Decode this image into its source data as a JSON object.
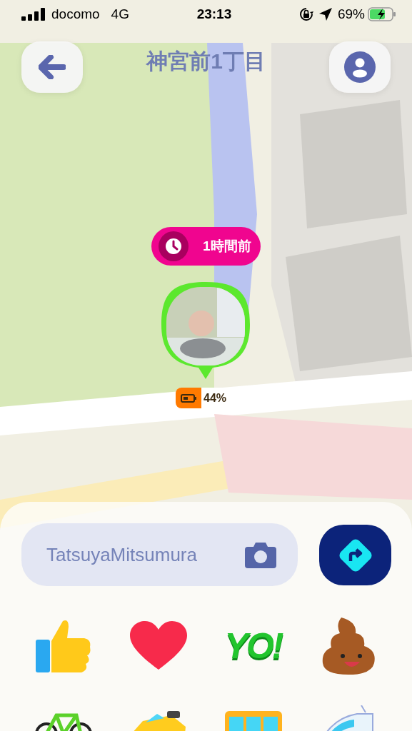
{
  "status_bar": {
    "carrier": "docomo",
    "network": "4G",
    "time": "23:13",
    "battery": "69%"
  },
  "header": {
    "title": "神宮前1丁目"
  },
  "map": {
    "kind": "picture",
    "time_bubble": "1時間前",
    "battery_badge": "44%"
  },
  "message": {
    "placeholder": "TatsuyaMitsumura"
  },
  "reactions": [
    {
      "kind": "thumbs_up"
    },
    {
      "kind": "heart"
    },
    {
      "kind": "yo",
      "label": "YO!"
    },
    {
      "kind": "poop"
    }
  ],
  "transports": [
    {
      "kind": "bicycle"
    },
    {
      "kind": "car"
    },
    {
      "kind": "bus"
    },
    {
      "kind": "train"
    }
  ]
}
